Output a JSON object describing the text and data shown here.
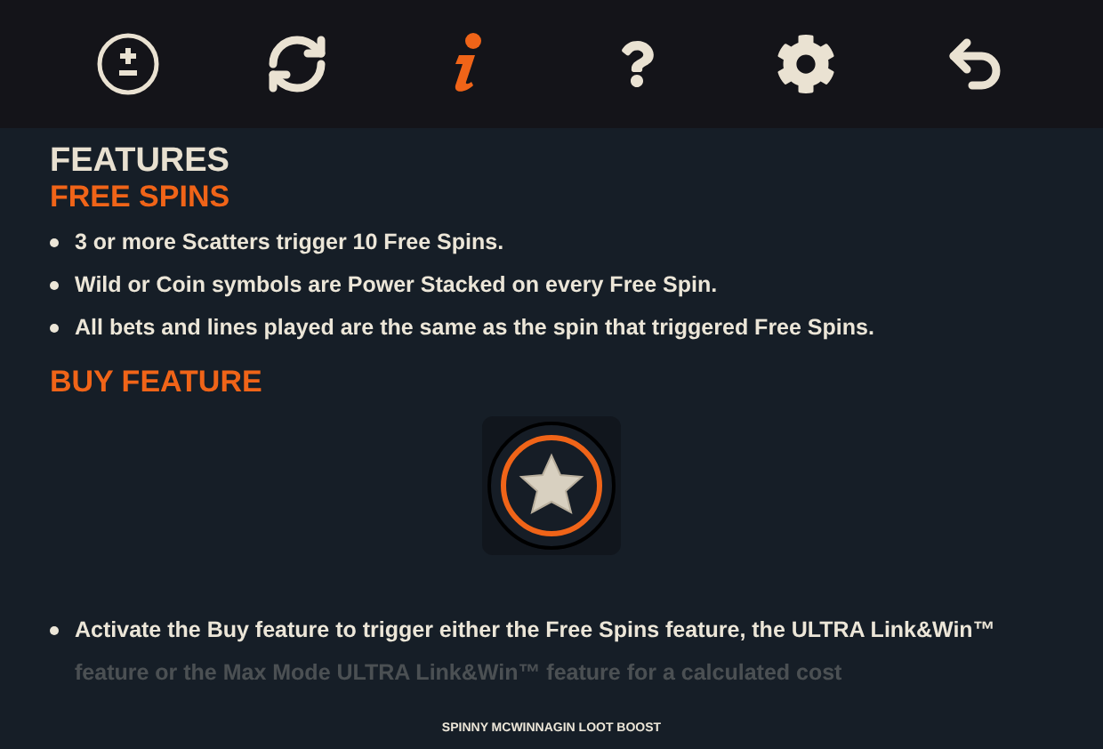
{
  "toolbar": [
    {
      "kind": "bet",
      "selected": false
    },
    {
      "kind": "autoplay",
      "selected": false
    },
    {
      "kind": "info",
      "selected": true
    },
    {
      "kind": "help",
      "selected": false
    },
    {
      "kind": "settings",
      "selected": false
    },
    {
      "kind": "back",
      "selected": false
    }
  ],
  "title": "FEATURES",
  "sections": [
    {
      "heading": "FREE SPINS",
      "items": [
        "3 or more Scatters trigger 10 Free Spins.",
        "Wild or Coin symbols are Power Stacked on every Free Spin.",
        "All bets and lines played are the same as the spin that triggered Free Spins."
      ]
    },
    {
      "heading": "BUY FEATURE",
      "kind": "buy",
      "items": [
        "Activate the Buy feature to trigger either the Free Spins feature, the ULTRA Link&Win™ feature or the Max Mode ULTRA Link&Win™ feature for a calculated cost"
      ]
    }
  ],
  "footer": "SPINNY MCWINNAGIN LOOT BOOST"
}
